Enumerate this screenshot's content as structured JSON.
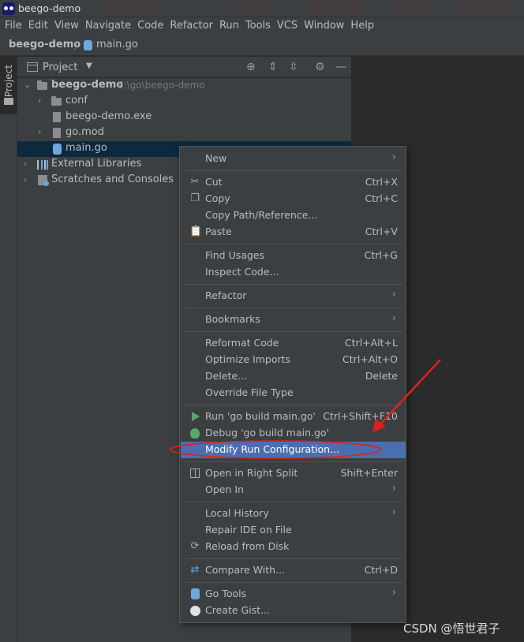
{
  "titlebar": {
    "title": "beego-demo"
  },
  "menubar": {
    "items": [
      "File",
      "Edit",
      "View",
      "Navigate",
      "Code",
      "Refactor",
      "Run",
      "Tools",
      "VCS",
      "Window",
      "Help"
    ]
  },
  "breadcrumb": {
    "project": "beego-demo",
    "file": "main.go"
  },
  "side_tab": {
    "label": "Project"
  },
  "project_panel": {
    "title": "Project",
    "tree": [
      {
        "label": "beego-demo",
        "path": "E:\\go\\beego-demo",
        "kind": "folder",
        "expanded": true
      },
      {
        "label": "conf",
        "kind": "folder",
        "expanded": false
      },
      {
        "label": "beego-demo.exe",
        "kind": "file"
      },
      {
        "label": "go.mod",
        "kind": "file",
        "expanded": false
      },
      {
        "label": "main.go",
        "kind": "go-file",
        "selected": true
      },
      {
        "label": "External Libraries",
        "kind": "libraries",
        "expanded": false
      },
      {
        "label": "Scratches and Consoles",
        "kind": "scratches",
        "expanded": false
      }
    ]
  },
  "context_menu": {
    "items": [
      {
        "label": "New",
        "submenu": true
      },
      {
        "label": "Cut",
        "shortcut": "Ctrl+X",
        "icon": "scissors-icon"
      },
      {
        "label": "Copy",
        "shortcut": "Ctrl+C",
        "icon": "copy-icon"
      },
      {
        "label": "Copy Path/Reference..."
      },
      {
        "label": "Paste",
        "shortcut": "Ctrl+V",
        "icon": "paste-icon"
      },
      {
        "label": "Find Usages",
        "shortcut": "Ctrl+G"
      },
      {
        "label": "Inspect Code..."
      },
      {
        "label": "Refactor",
        "submenu": true
      },
      {
        "label": "Bookmarks",
        "submenu": true
      },
      {
        "label": "Reformat Code",
        "shortcut": "Ctrl+Alt+L"
      },
      {
        "label": "Optimize Imports",
        "shortcut": "Ctrl+Alt+O"
      },
      {
        "label": "Delete...",
        "shortcut": "Delete"
      },
      {
        "label": "Override File Type"
      },
      {
        "label": "Run 'go build main.go'",
        "shortcut": "Ctrl+Shift+F10",
        "icon": "run-icon"
      },
      {
        "label": "Debug 'go build main.go'",
        "icon": "debug-icon"
      },
      {
        "label": "Modify Run Configuration...",
        "highlighted": true
      },
      {
        "label": "Open in Right Split",
        "shortcut": "Shift+Enter",
        "icon": "split-icon"
      },
      {
        "label": "Open In",
        "submenu": true
      },
      {
        "label": "Local History",
        "submenu": true
      },
      {
        "label": "Repair IDE on File"
      },
      {
        "label": "Reload from Disk",
        "icon": "reload-icon"
      },
      {
        "label": "Compare With...",
        "shortcut": "Ctrl+D",
        "icon": "compare-icon"
      },
      {
        "label": "Go Tools",
        "submenu": true,
        "icon": "gopher-icon"
      },
      {
        "label": "Create Gist...",
        "icon": "github-icon"
      }
    ]
  },
  "watermark": "CSDN @悟世君子",
  "colors": {
    "selection": "#4b6eaf",
    "annotation": "#e02020",
    "tree_selection": "#0d293e"
  }
}
